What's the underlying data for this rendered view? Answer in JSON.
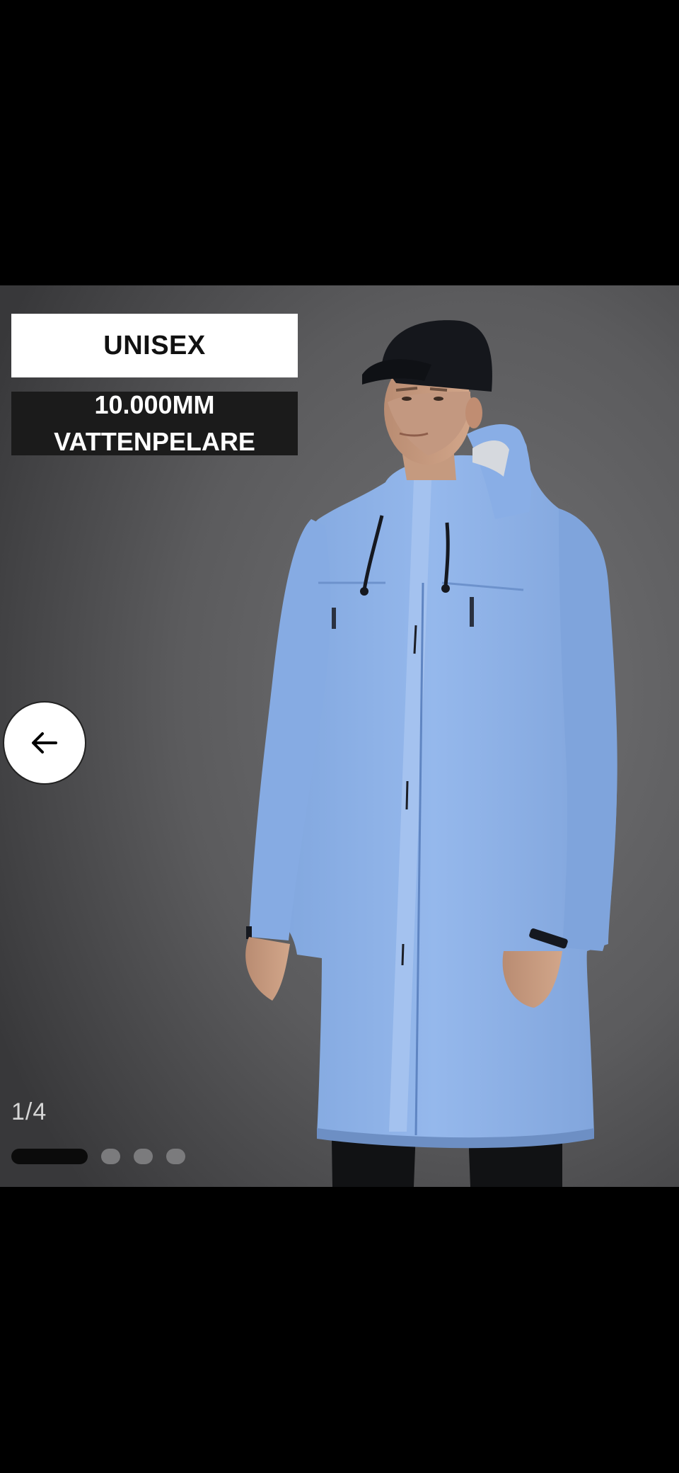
{
  "product_gallery": {
    "badges": {
      "unisex": "UNISEX",
      "spec_line1": "10.000MM",
      "spec_line2": "VATTENPELARE"
    },
    "image_alt": "Model wearing light blue long rain jacket with black cap",
    "back_icon": "arrow-left-icon",
    "pagination": {
      "counter": "1/4",
      "current": 1,
      "total": 4
    }
  },
  "colors": {
    "jacket": "#8fb4ea",
    "background_gray": "#5d5d5f",
    "badge_dark": "#1b1b1b"
  }
}
